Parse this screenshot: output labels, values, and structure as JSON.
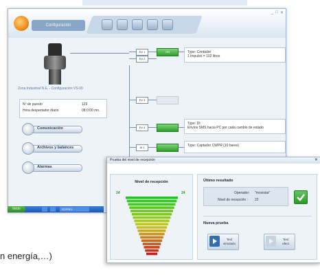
{
  "app": {
    "tab_label": "Configuración"
  },
  "device_caption": "Zona Industrial N.E. - Configuración VS-00",
  "info": [
    {
      "label": "Nº de puesto",
      "value": "123"
    },
    {
      "label": "Hora despertador diario",
      "value": "08:0:00 mn."
    }
  ],
  "nav": [
    {
      "label": "Comunicación"
    },
    {
      "label": "Archivos y balances"
    },
    {
      "label": "Alarmas"
    }
  ],
  "channels": [
    {
      "tag": "EV 1",
      "button": "ON",
      "desc1": "Type: Contador",
      "desc2": "1 impulso = 102 litros",
      "active": true
    },
    {
      "tag": "EV 2",
      "button": "",
      "desc1": "",
      "desc2": "",
      "active": true
    },
    {
      "tag": "EV 3",
      "button": "",
      "desc1": "",
      "desc2": "",
      "active": false
    },
    {
      "tag": "EV 4",
      "button": "",
      "desc1": "Type: DI",
      "desc2": "Envíos SMS hacia PC por cada cambio de estado",
      "active": true
    },
    {
      "tag": "AI 1",
      "button": "",
      "desc1": "Type: Captador CWPR (10 bares)",
      "desc2": "",
      "active": true
    }
  ],
  "taskbar": {
    "start": "Inicio",
    "item": "SOFREL"
  },
  "dialog": {
    "title": "Prueba del nivel de recepción",
    "level_header": "Nivel de recepción",
    "left_mark": "24",
    "right_mark": "24",
    "result_header": "Último resultado",
    "operator_label": "Operador:",
    "operator_value": "\"movistar\"",
    "level_label": "Nivel de recepción :",
    "level_value": "22",
    "new_test_header": "Nueva prueba",
    "btn_simple": "Test\nsimulado",
    "btn_real": "Test\nefect"
  },
  "bottom_text": "n energía,…)"
}
